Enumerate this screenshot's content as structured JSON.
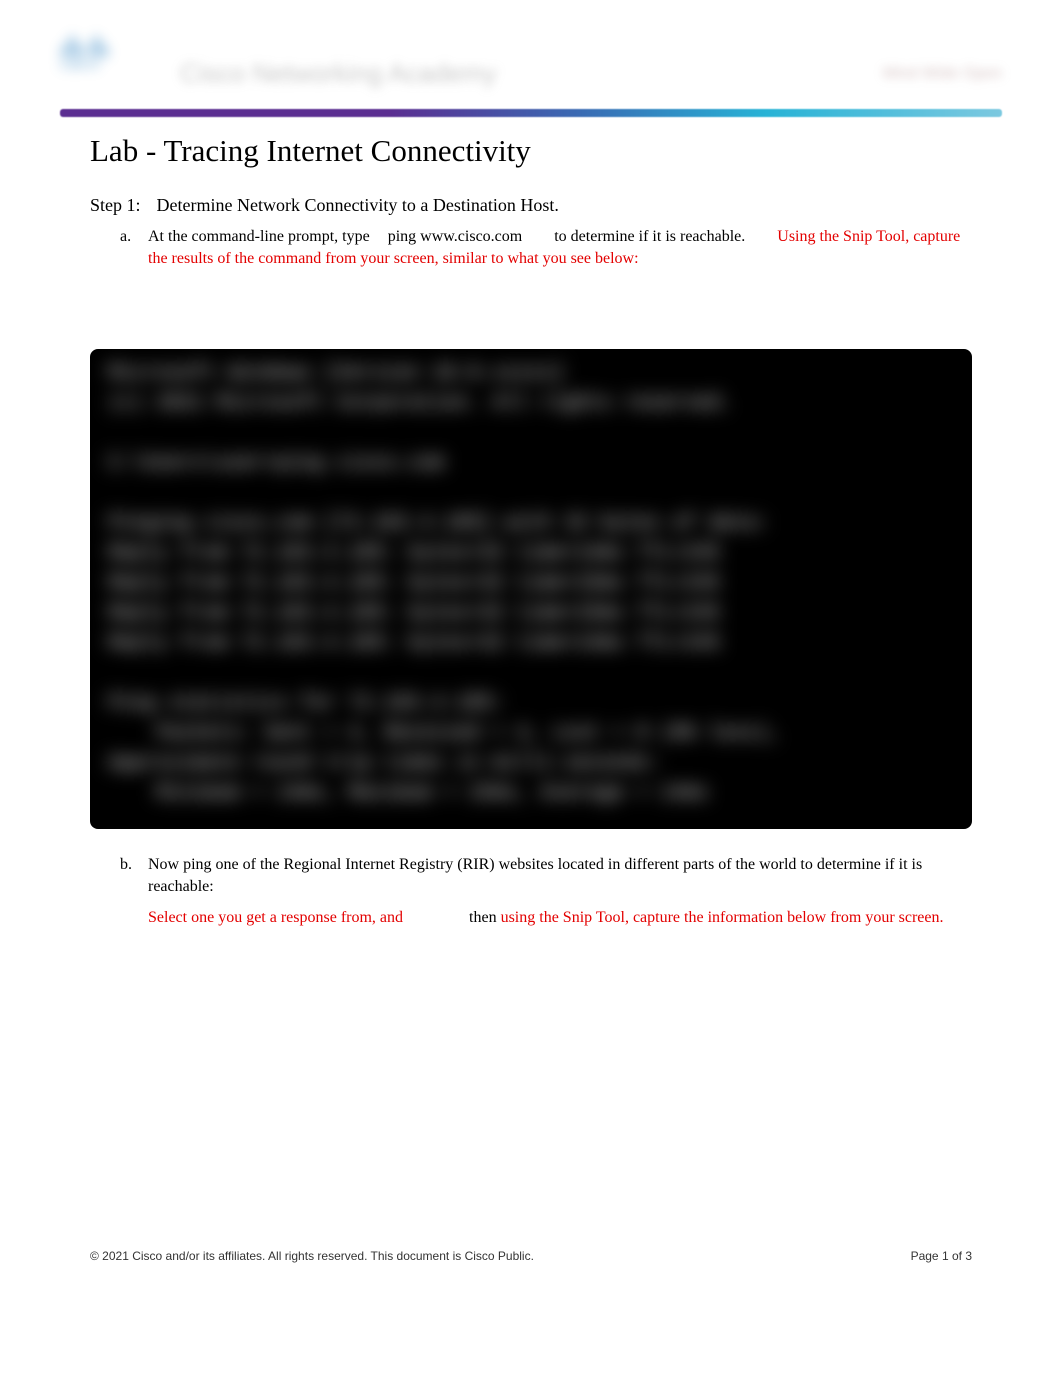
{
  "header": {
    "academy_text": "Cisco Networking Academy",
    "right_text": "Mind Wide Open"
  },
  "title": "Lab - Tracing Internet Connectivity",
  "step": {
    "label": "Step 1:",
    "text": "Determine Network Connectivity to a Destination Host."
  },
  "items": {
    "a": {
      "marker": "a.",
      "t1": "At the command-line prompt, type",
      "cmd": "ping www.cisco.com",
      "t2": "to determine if it is reachable.",
      "red": "Using the Snip Tool, capture the results of the command from your screen, similar to what you see below:"
    },
    "b": {
      "marker": "b.",
      "t1": "Now ping one of the Regional Internet Registry (RIR) websites located in different parts of the world to determine if it is reachable:",
      "red1": "Select one you get a response from, and",
      "mid": "then",
      "red2": "using the Snip Tool, capture the information below from your screen."
    }
  },
  "terminal": "Microsoft Windows [Version 10.0.xxxxx]\n(c) 2021 Microsoft Corporation. All rights reserved.\n\nC:\\Users\\user>ping cisco.com\n\nPinging cisco.com [72.163.4.185] with 32 bytes of data:\nReply from 72.163.4.185: bytes=32 time=14ms TTL=245\nReply from 72.163.4.185: bytes=32 time=15ms TTL=245\nReply from 72.163.4.185: bytes=32 time=15ms TTL=245\nReply from 72.163.4.185: bytes=32 time=14ms TTL=245\n\nPing statistics for 72.163.4.185:\n    Packets: Sent = 4, Received = 4, Lost = 0 (0% loss),\nApproximate round trip times in milli-seconds:\n    Minimum = 14ms, Maximum = 15ms, Average = 14ms\n\nC:\\Users\\user>",
  "footer": {
    "copyright": "© 2021 Cisco and/or its affiliates. All rights reserved. This document is Cisco Public.",
    "page_label": "Page",
    "page_num": "1",
    "page_of": "of 3"
  }
}
